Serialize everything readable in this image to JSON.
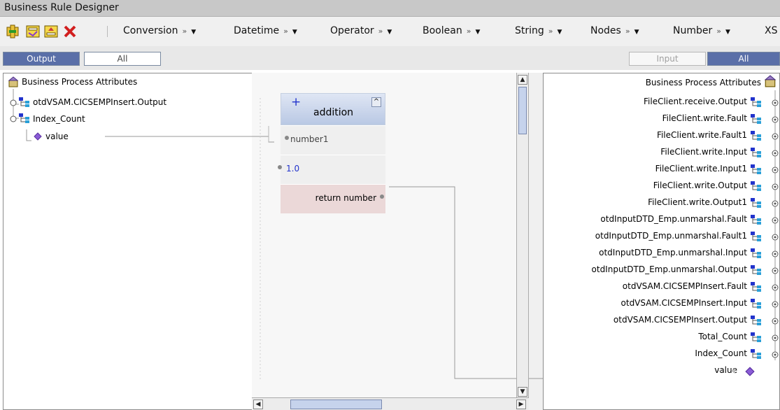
{
  "window": {
    "title": "Business Rule Designer"
  },
  "toolbar": {
    "icons": [
      "add-rule-icon",
      "edit-rule-icon",
      "import-rule-icon",
      "delete-icon"
    ],
    "menus": [
      "Conversion",
      "Datetime",
      "Operator",
      "Boolean",
      "String",
      "Nodes",
      "Number",
      "XS"
    ]
  },
  "left_filter": {
    "output_label": "Output",
    "all_label": "All"
  },
  "right_filter": {
    "input_label": "Input",
    "all_label": "All"
  },
  "left_tree": {
    "root": "Business Process Attributes",
    "items": [
      "otdVSAM.CICSEMPInsert.Output",
      "Index_Count"
    ],
    "child": "value"
  },
  "method": {
    "plus": "+",
    "name": "addition",
    "collapse": "^",
    "param1": "number1",
    "param2": "1.0",
    "return": "return number"
  },
  "right_tree": {
    "root": "Business Process Attributes",
    "items": [
      "FileClient.receive.Output",
      "FileClient.write.Fault",
      "FileClient.write.Fault1",
      "FileClient.write.Input",
      "FileClient.write.Input1",
      "FileClient.write.Output",
      "FileClient.write.Output1",
      "otdInputDTD_Emp.unmarshal.Fault",
      "otdInputDTD_Emp.unmarshal.Fault1",
      "otdInputDTD_Emp.unmarshal.Input",
      "otdInputDTD_Emp.unmarshal.Output",
      "otdVSAM.CICSEMPInsert.Fault",
      "otdVSAM.CICSEMPInsert.Input",
      "otdVSAM.CICSEMPInsert.Output",
      "Total_Count",
      "Index_Count"
    ],
    "child": "value"
  },
  "colors": {
    "active_tab": "#5a6fa8",
    "accent_blue": "#2233cc",
    "diamond": "#8a5cd6"
  }
}
